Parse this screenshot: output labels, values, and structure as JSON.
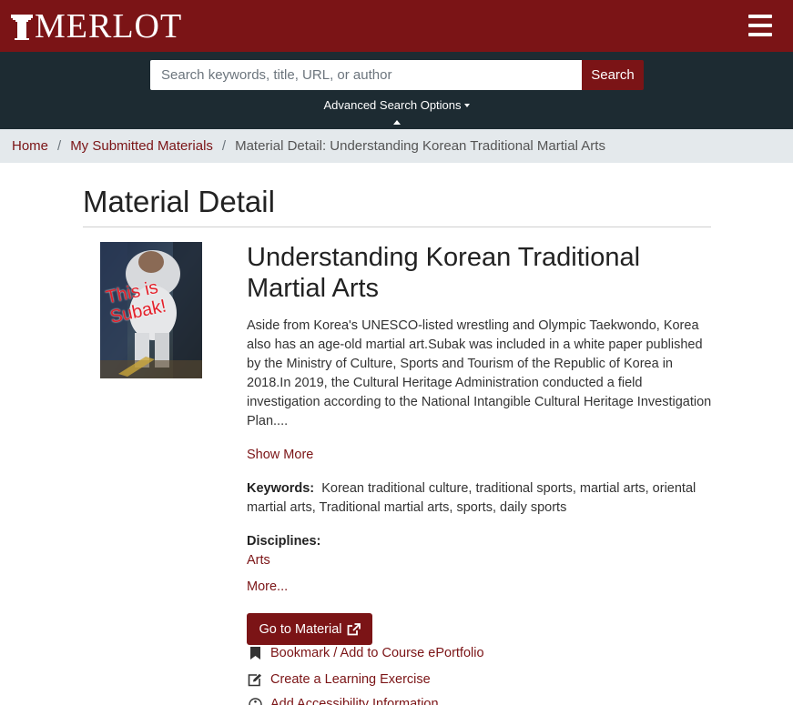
{
  "header": {
    "logo_text": "MERLOT",
    "menu_icon": "hamburger-icon",
    "brand_color": "#7b1416"
  },
  "search": {
    "placeholder": "Search keywords, title, URL, or author",
    "button_label": "Search",
    "advanced_label": "Advanced Search Options"
  },
  "breadcrumb": {
    "items": [
      "Home",
      "My Submitted Materials"
    ],
    "current": "Material Detail: Understanding Korean Traditional Martial Arts"
  },
  "page": {
    "title": "Material Detail"
  },
  "material": {
    "thumbnail_text": "This is Subak!",
    "title": "Understanding Korean Traditional Martial Arts",
    "description": "Aside from Korea's UNESCO-listed wrestling and Olympic Taekwondo, Korea also has an age-old martial art.Subak was included in a white paper published by the Ministry of Culture, Sports and Tourism of the Republic of Korea in 2018.In 2019, the Cultural Heritage Administration conducted a field investigation according to the National Intangible Cultural Heritage Investigation Plan....",
    "show_more": "Show More",
    "keywords_label": "Keywords:",
    "keywords": "Korean traditional culture, traditional sports, martial arts, oriental martial arts, Traditional martial arts, sports, daily sports",
    "disciplines_label": "Disciplines:",
    "disciplines": [
      "Arts"
    ],
    "more_link": "More..."
  },
  "actions": {
    "goto_label": "Go to Material",
    "goto_icon": "external-link-icon",
    "items": [
      {
        "label": "Bookmark / Add to Course ePortfolio",
        "icon": "bookmark-icon"
      },
      {
        "label": "Create a Learning Exercise",
        "icon": "edit-icon"
      },
      {
        "label": "Add Accessibility Information",
        "icon": "accessibility-icon"
      }
    ]
  }
}
